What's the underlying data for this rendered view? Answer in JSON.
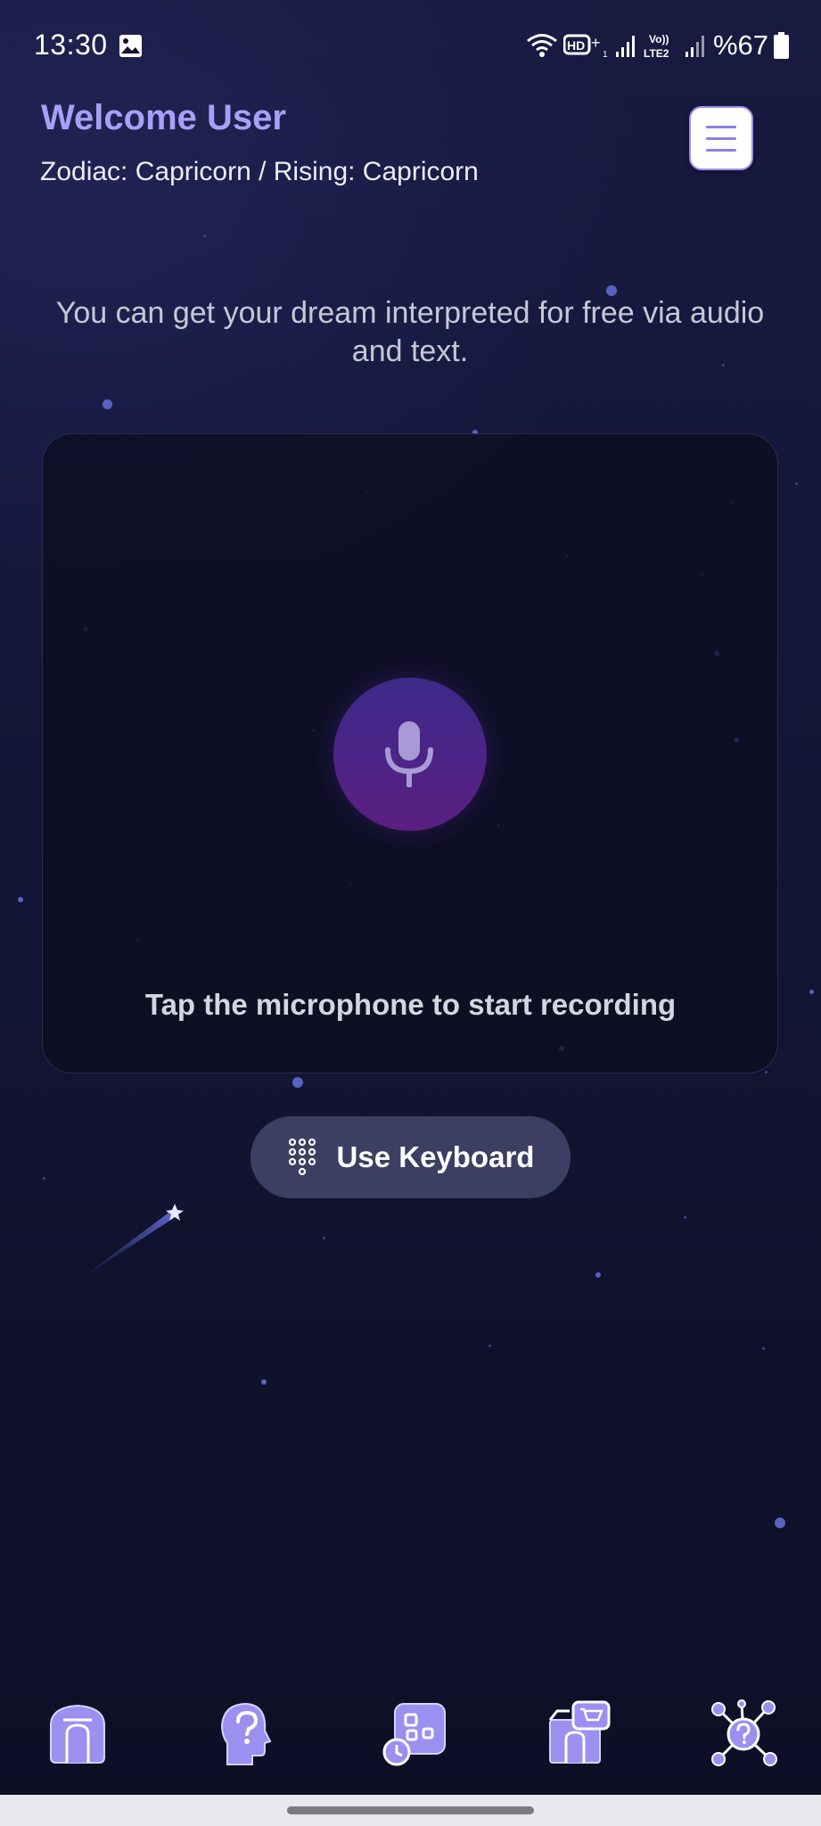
{
  "status_bar": {
    "time": "13:30",
    "battery": "%67",
    "icons": [
      "image-icon",
      "wifi-icon",
      "hd-voice-icon",
      "signal-icon",
      "volte-icon",
      "signal-icon-2",
      "battery-icon"
    ]
  },
  "header": {
    "welcome": "Welcome User",
    "zodiac": "Zodiac: Capricorn / Rising: Capricorn",
    "menu_icon": "hamburger-menu-icon"
  },
  "main": {
    "intro": "You can get your dream interpreted for free via audio and text.",
    "mic_icon": "microphone-icon",
    "hint": "Tap the microphone to start recording",
    "keyboard_button": "Use Keyboard",
    "keyboard_icon": "keypad-icon"
  },
  "nav": {
    "items": [
      {
        "name": "home",
        "icon": "home-icon"
      },
      {
        "name": "dream-consult",
        "icon": "head-question-icon"
      },
      {
        "name": "history",
        "icon": "apps-clock-icon"
      },
      {
        "name": "shop",
        "icon": "shop-icon"
      },
      {
        "name": "network",
        "icon": "network-question-icon"
      }
    ]
  },
  "colors": {
    "accent": "#a8a0f8",
    "background": "#10122a",
    "mic_button": "#4a2588",
    "keyboard_button": "#3c3f62",
    "nav_icon": "#9b8ff0"
  }
}
